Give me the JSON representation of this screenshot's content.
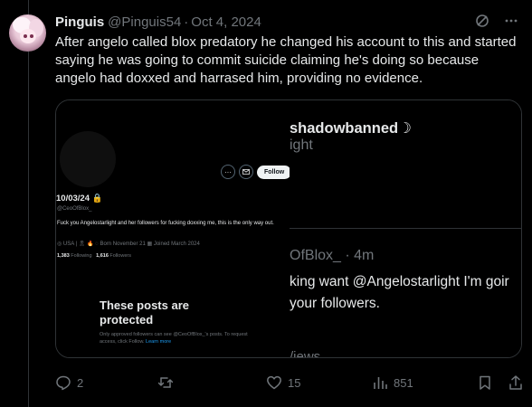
{
  "tweet": {
    "author_name": "Pinguis",
    "author_handle": "@Pinguis54",
    "separator": "·",
    "date": "Oct 4, 2024",
    "text": "After angelo called blox predatory he changed his account to this and started saying he was going to commit suicide claiming he's doing so because angelo had doxxed and harrased him, providing no evidence."
  },
  "media_left": {
    "follow_label": "Follow",
    "more_label": "···",
    "display_name": "10/03/24",
    "handle": "@CeoOfBlox_",
    "bio": "Fuck you Angelostarlight and her followers for fucking doxxing me, this is the only way out.",
    "meta": "◎ USA | 🎗 🔥   ◌ Born November 21   ▦ Joined March 2024",
    "following_count": "1,383",
    "following_label": "Following",
    "followers_count": "1,616",
    "followers_label": "Followers",
    "protected_title": "These posts are protected",
    "protected_body": "Only approved followers can see @CeoOfBlox_'s posts. To request access, click Follow.",
    "learn_more": "Learn more"
  },
  "media_right": {
    "line1": "shadowbanned☽",
    "line2": "ight",
    "line3": "OfBlox_ · 4m",
    "line4": "king want @Angelostarlight I'm goir",
    "line5": "your followers.",
    "line6": "/iews"
  },
  "actions": {
    "replies": "2",
    "retweets": "",
    "likes": "15",
    "views": "851"
  },
  "colors": {
    "background": "#000000",
    "text": "#e7e9ea",
    "muted": "#71767b",
    "border": "#2f3336",
    "link": "#1d9bf0"
  }
}
